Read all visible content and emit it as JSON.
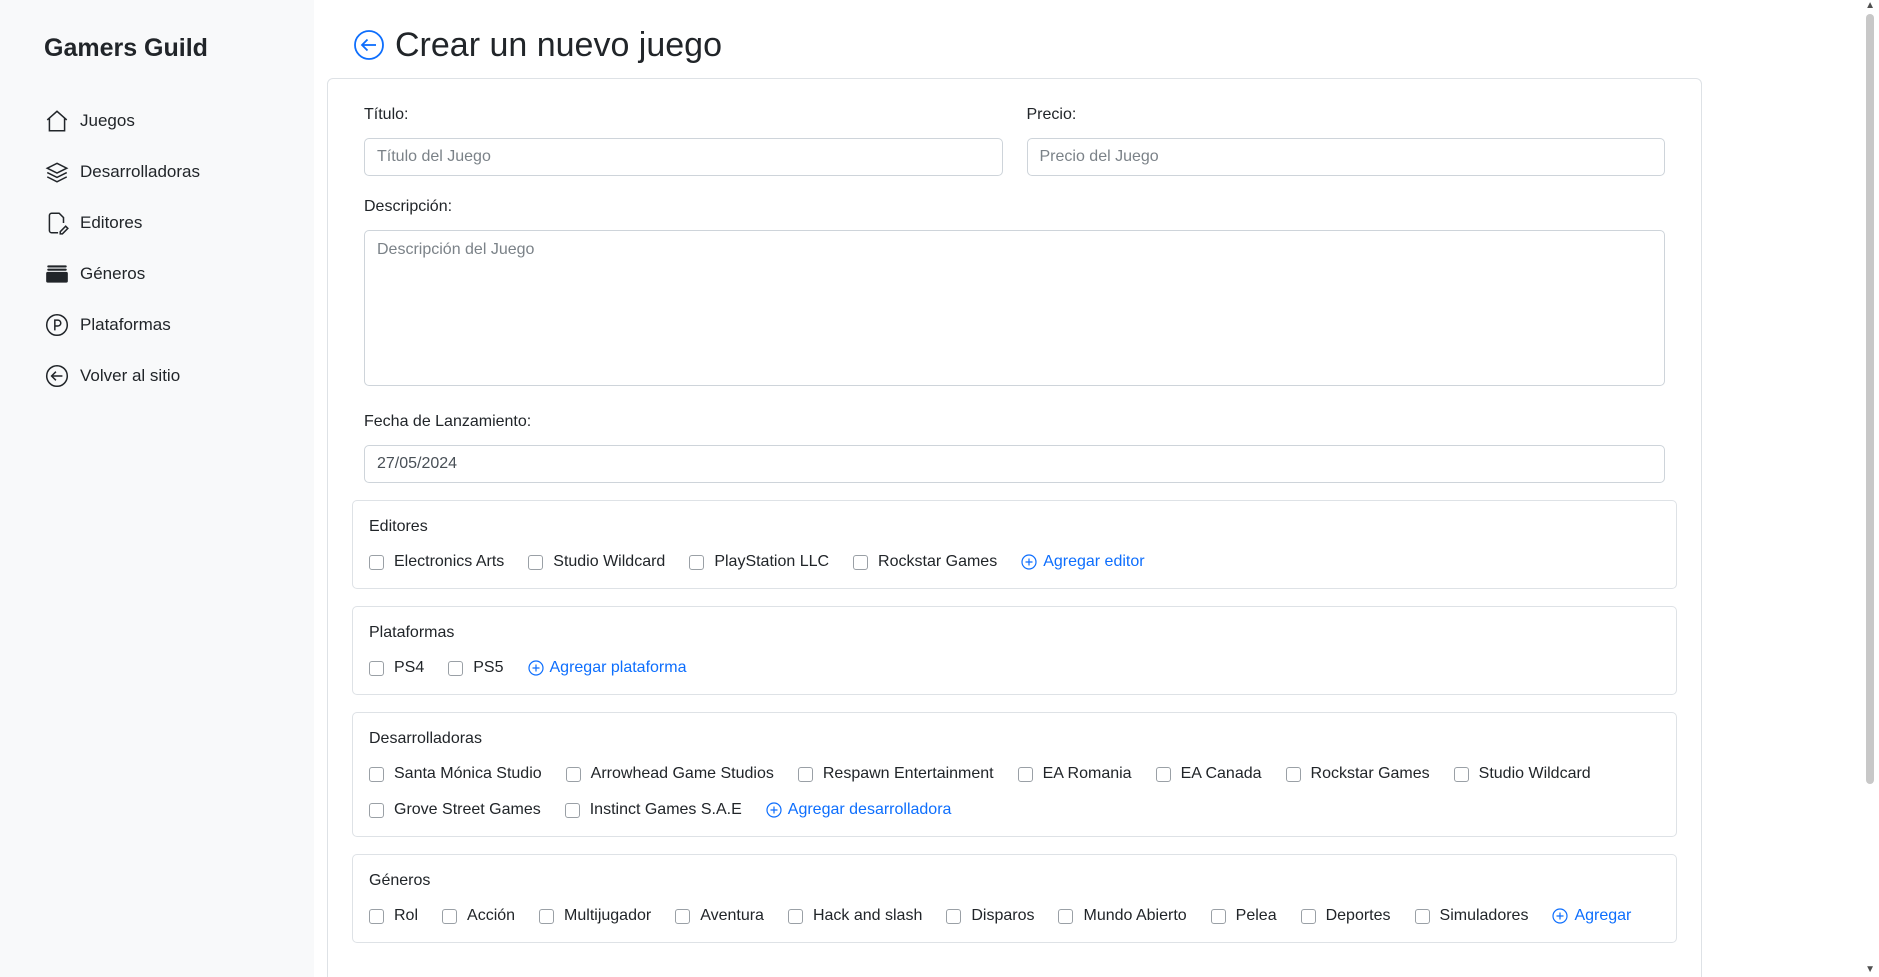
{
  "sidebar": {
    "brand": "Gamers Guild",
    "items": [
      {
        "label": "Juegos",
        "icon": "house-icon"
      },
      {
        "label": "Desarrolladoras",
        "icon": "layers-icon"
      },
      {
        "label": "Editores",
        "icon": "file-pen-icon"
      },
      {
        "label": "Géneros",
        "icon": "archive-icon"
      },
      {
        "label": "Plataformas",
        "icon": "p-circle-icon"
      },
      {
        "label": "Volver al sitio",
        "icon": "arrow-left-circle-icon"
      }
    ]
  },
  "header": {
    "title": "Crear un nuevo juego"
  },
  "form": {
    "titulo_label": "Título:",
    "titulo_placeholder": "Título del Juego",
    "precio_label": "Precio:",
    "precio_placeholder": "Precio del Juego",
    "descripcion_label": "Descripción:",
    "descripcion_placeholder": "Descripción del Juego",
    "fecha_label": "Fecha de Lanzamiento:",
    "fecha_value": "27/05/2024"
  },
  "editores": {
    "title": "Editores",
    "options": [
      "Electronics Arts",
      "Studio Wildcard",
      "PlayStation LLC",
      "Rockstar Games"
    ],
    "add_label": "Agregar editor"
  },
  "plataformas": {
    "title": "Plataformas",
    "options": [
      "PS4",
      "PS5"
    ],
    "add_label": "Agregar plataforma"
  },
  "desarrolladoras": {
    "title": "Desarrolladoras",
    "options": [
      "Santa Mónica Studio",
      "Arrowhead Game Studios",
      "Respawn Entertainment",
      "EA Romania",
      "EA Canada",
      "Rockstar Games",
      "Studio Wildcard",
      "Grove Street Games",
      "Instinct Games S.A.E"
    ],
    "add_label": "Agregar desarrolladora"
  },
  "generos": {
    "title": "Géneros",
    "options": [
      "Rol",
      "Acción",
      "Multijugador",
      "Aventura",
      "Hack and slash",
      "Disparos",
      "Mundo Abierto",
      "Pelea",
      "Deportes",
      "Simuladores"
    ],
    "add_label": "Agregar"
  },
  "colors": {
    "accent": "#0d6efd",
    "sidebar_bg": "#f8f9fa",
    "border": "#dee2e6"
  }
}
